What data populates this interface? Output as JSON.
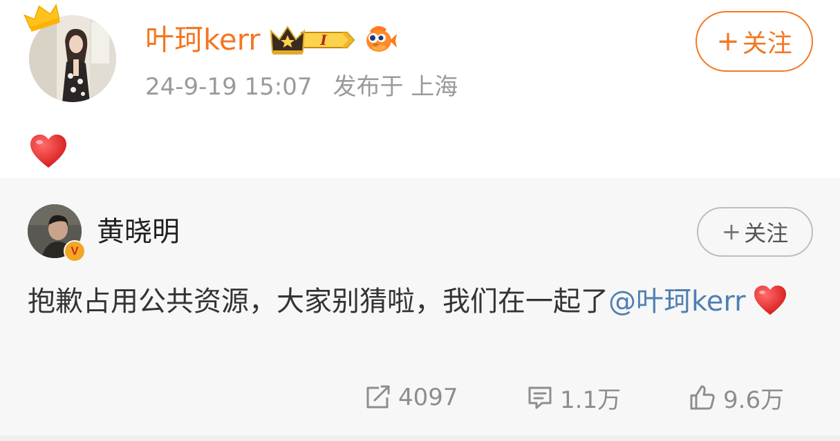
{
  "author": {
    "name": "叶珂kerr",
    "avatar": "user-photo",
    "crown_icon": "crown-icon",
    "vip_level": "I",
    "fish_icon": "goldfish-icon",
    "name_color": "#f47721"
  },
  "post": {
    "time": "24-9-19 15:07",
    "location": "发布于 上海",
    "content_icon": "red-heart-icon"
  },
  "follow_button": {
    "plus": "+",
    "label": "关注",
    "color": "#f47721"
  },
  "repost": {
    "author_name": "黄晓明",
    "verified_badge": "V",
    "follow_button": {
      "plus": "+",
      "label": "关注"
    },
    "text": "抱歉占用公共资源，大家别猜啦，我们在一起了",
    "mention": "@叶珂kerr",
    "mention_color": "#4f7fb3",
    "trailing_icon": "red-heart-icon",
    "background": "#f7f7f7",
    "stats": {
      "reposts": "4097",
      "comments": "1.1万",
      "likes": "9.6万"
    }
  }
}
